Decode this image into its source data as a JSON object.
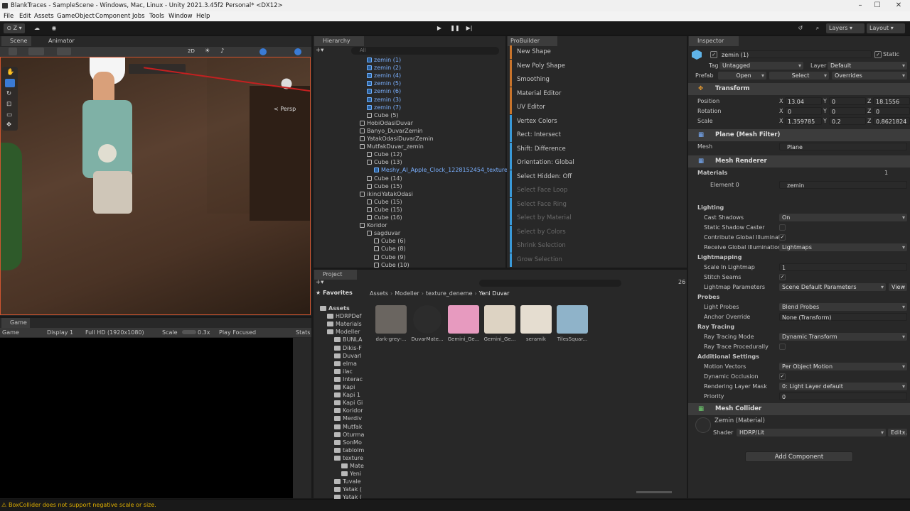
{
  "window": {
    "title": "BlankTraces - SampleScene - Windows, Mac, Linux - Unity 2021.3.45f2 Personal* <DX12>"
  },
  "menu": [
    "File",
    "Edit",
    "Assets",
    "GameObject",
    "Component",
    "Jobs",
    "Tools",
    "Window",
    "Help"
  ],
  "toolbar": {
    "account": "Z",
    "layers": "Layers",
    "layout": "Layout"
  },
  "scene": {
    "tab_scene": "Scene",
    "tab_animator": "Animator",
    "persp": "< Persp",
    "mode_2d": "2D"
  },
  "game": {
    "tab": "Game",
    "mode": "Game",
    "display": "Display 1",
    "resolution": "Full HD (1920x1080)",
    "scale_label": "Scale",
    "scale_value": "0.3x",
    "play_focused": "Play Focused",
    "stats": "Stats"
  },
  "hierarchy": {
    "tab": "Hierarchy",
    "search_placeholder": "All",
    "items": [
      {
        "label": "zemin (1)",
        "blue": true,
        "indent": 2
      },
      {
        "label": "zemin (2)",
        "blue": true,
        "indent": 2
      },
      {
        "label": "zemin (4)",
        "blue": true,
        "indent": 2
      },
      {
        "label": "zemin (5)",
        "blue": true,
        "indent": 2
      },
      {
        "label": "zemin (6)",
        "blue": true,
        "indent": 2
      },
      {
        "label": "zemin (3)",
        "blue": true,
        "indent": 2
      },
      {
        "label": "zemin (7)",
        "blue": true,
        "indent": 2
      },
      {
        "label": "Cube (5)",
        "blue": false,
        "indent": 2
      },
      {
        "label": "HobiOdasiDuvar",
        "blue": false,
        "indent": 1
      },
      {
        "label": "Banyo_DuvarZemin",
        "blue": false,
        "indent": 1
      },
      {
        "label": "YatakOdasiDuvarZemin",
        "blue": false,
        "indent": 1
      },
      {
        "label": "MutfakDuvar_zemin",
        "blue": false,
        "indent": 1
      },
      {
        "label": "Cube (12)",
        "blue": false,
        "indent": 2
      },
      {
        "label": "Cube (13)",
        "blue": false,
        "indent": 2
      },
      {
        "label": "Meshy_AI_Apple_Clock_1228152454_texture",
        "blue": true,
        "indent": 3
      },
      {
        "label": "Cube (14)",
        "blue": false,
        "indent": 2
      },
      {
        "label": "Cube (15)",
        "blue": false,
        "indent": 2
      },
      {
        "label": "ikinciYatakOdasi",
        "blue": false,
        "indent": 1
      },
      {
        "label": "Cube (15)",
        "blue": false,
        "indent": 2
      },
      {
        "label": "Cube (15)",
        "blue": false,
        "indent": 2
      },
      {
        "label": "Cube (16)",
        "blue": false,
        "indent": 2
      },
      {
        "label": "Koridor",
        "blue": false,
        "indent": 1
      },
      {
        "label": "sagduvar",
        "blue": false,
        "indent": 2
      },
      {
        "label": "Cube (6)",
        "blue": false,
        "indent": 3
      },
      {
        "label": "Cube (8)",
        "blue": false,
        "indent": 3
      },
      {
        "label": "Cube (9)",
        "blue": false,
        "indent": 3
      },
      {
        "label": "Cube (10)",
        "blue": false,
        "indent": 3
      }
    ]
  },
  "probuilder": {
    "tab": "ProBuilder",
    "items": [
      {
        "label": "New Shape",
        "color": "#c8742c",
        "enabled": true
      },
      {
        "label": "New Poly Shape",
        "color": "#c8742c",
        "enabled": true
      },
      {
        "label": "Smoothing",
        "color": "#c8742c",
        "enabled": true
      },
      {
        "label": "Material Editor",
        "color": "#c8742c",
        "enabled": true
      },
      {
        "label": "UV Editor",
        "color": "#c8742c",
        "enabled": true
      },
      {
        "label": "Vertex Colors",
        "color": "#3a9ad9",
        "enabled": true
      },
      {
        "label": "Rect: Intersect",
        "color": "#3a9ad9",
        "enabled": true
      },
      {
        "label": "Shift: Difference",
        "color": "#3a9ad9",
        "enabled": true
      },
      {
        "label": "Orientation: Global",
        "color": "#3a9ad9",
        "enabled": true
      },
      {
        "label": "Select Hidden: Off",
        "color": "#3a9ad9",
        "enabled": true
      },
      {
        "label": "Select Face Loop",
        "color": "#3a9ad9",
        "enabled": false
      },
      {
        "label": "Select Face Ring",
        "color": "#3a9ad9",
        "enabled": false
      },
      {
        "label": "Select by Material",
        "color": "#3a9ad9",
        "enabled": false
      },
      {
        "label": "Select by Colors",
        "color": "#3a9ad9",
        "enabled": false
      },
      {
        "label": "Shrink Selection",
        "color": "#3a9ad9",
        "enabled": false
      },
      {
        "label": "Grow Selection",
        "color": "#3a9ad9",
        "enabled": false
      }
    ]
  },
  "project": {
    "tab": "Project",
    "favorites": "Favorites",
    "count": "26",
    "breadcrumb": [
      "Assets",
      "Modeller",
      "texture_deneme",
      "Yeni Duvar"
    ],
    "tree": [
      {
        "label": "Assets",
        "indent": 0,
        "bold": true
      },
      {
        "label": "HDRPDef",
        "indent": 1
      },
      {
        "label": "Materials",
        "indent": 1
      },
      {
        "label": "Modeller",
        "indent": 1
      },
      {
        "label": "BUNLA",
        "indent": 2
      },
      {
        "label": "Dikis-F",
        "indent": 2
      },
      {
        "label": "Duvarl",
        "indent": 2
      },
      {
        "label": "elma",
        "indent": 2
      },
      {
        "label": "ilac",
        "indent": 2
      },
      {
        "label": "Interac",
        "indent": 2
      },
      {
        "label": "Kapi",
        "indent": 2
      },
      {
        "label": "Kapi 1",
        "indent": 2
      },
      {
        "label": "Kapi Gi",
        "indent": 2
      },
      {
        "label": "Koridor",
        "indent": 2
      },
      {
        "label": "Merdiv",
        "indent": 2
      },
      {
        "label": "Mutfak",
        "indent": 2
      },
      {
        "label": "Oturma",
        "indent": 2
      },
      {
        "label": "SonMo",
        "indent": 2
      },
      {
        "label": "tablolm",
        "indent": 2
      },
      {
        "label": "texture",
        "indent": 2
      },
      {
        "label": "Mate",
        "indent": 3
      },
      {
        "label": "Yeni",
        "indent": 3
      },
      {
        "label": "Tuvale",
        "indent": 2
      },
      {
        "label": "Yatak (",
        "indent": 2
      },
      {
        "label": "Yatak (",
        "indent": 2
      }
    ],
    "assets": [
      {
        "label": "dark-grey-...",
        "color": "#6a6560"
      },
      {
        "label": "DuvarMate...",
        "color": "#2c2c2c"
      },
      {
        "label": "Gemini_Ge...",
        "color": "#e79abf"
      },
      {
        "label": "Gemini_Ge...",
        "color": "#ddd3c3"
      },
      {
        "label": "seramik",
        "color": "#e5ddd0"
      },
      {
        "label": "TilesSquar...",
        "color": "#8fb3c9"
      }
    ]
  },
  "inspector": {
    "tab": "Inspector",
    "object_name": "zemin (1)",
    "static_label": "Static",
    "tag_label": "Tag",
    "tag_value": "Untagged",
    "layer_label": "Layer",
    "layer_value": "Default",
    "prefab_label": "Prefab",
    "prefab_open": "Open",
    "prefab_select": "Select",
    "prefab_overrides": "Overrides",
    "transform": {
      "title": "Transform",
      "position_label": "Position",
      "position": {
        "x": "13.04",
        "y": "0",
        "z": "18.1556"
      },
      "rotation_label": "Rotation",
      "rotation": {
        "x": "0",
        "y": "0",
        "z": "0"
      },
      "scale_label": "Scale",
      "scale": {
        "x": "1.359785",
        "y": "0.2",
        "z": "0.8621824"
      }
    },
    "mesh_filter": {
      "title": "Plane (Mesh Filter)",
      "mesh_label": "Mesh",
      "mesh_value": "Plane"
    },
    "mesh_renderer": {
      "title": "Mesh Renderer",
      "materials_label": "Materials",
      "materials_count": "1",
      "element0_label": "Element 0",
      "element0_value": "zemin",
      "lighting_label": "Lighting",
      "cast_shadows_label": "Cast Shadows",
      "cast_shadows_value": "On",
      "static_shadow_caster_label": "Static Shadow Caster",
      "contribute_gi_label": "Contribute Global Illuminatio",
      "receive_gi_label": "Receive Global Illumination",
      "receive_gi_value": "Lightmaps",
      "lightmapping_label": "Lightmapping",
      "scale_in_lightmap_label": "Scale In Lightmap",
      "scale_in_lightmap_value": "1",
      "stitch_seams_label": "Stitch Seams",
      "lightmap_params_label": "Lightmap Parameters",
      "lightmap_params_value": "Scene Default Parameters",
      "view_button": "View",
      "probes_label": "Probes",
      "light_probes_label": "Light Probes",
      "light_probes_value": "Blend Probes",
      "anchor_override_label": "Anchor Override",
      "anchor_override_value": "None (Transform)",
      "ray_tracing_label": "Ray Tracing",
      "ray_tracing_mode_label": "Ray Tracing Mode",
      "ray_tracing_mode_value": "Dynamic Transform",
      "ray_trace_procedurally_label": "Ray Trace Procedurally",
      "additional_settings_label": "Additional Settings",
      "motion_vectors_label": "Motion Vectors",
      "motion_vectors_value": "Per Object Motion",
      "dynamic_occlusion_label": "Dynamic Occlusion",
      "rendering_layer_mask_label": "Rendering Layer Mask",
      "rendering_layer_mask_value": "0: Light Layer default",
      "priority_label": "Priority",
      "priority_value": "0"
    },
    "mesh_collider": {
      "title": "Mesh Collider"
    },
    "material": {
      "name": "Zemin (Material)",
      "shader_label": "Shader",
      "shader_value": "HDRP/Lit",
      "edit_button": "Edit..."
    },
    "add_component": "Add Component"
  },
  "status": {
    "message": "BoxCollider does not support negative scale or size."
  }
}
